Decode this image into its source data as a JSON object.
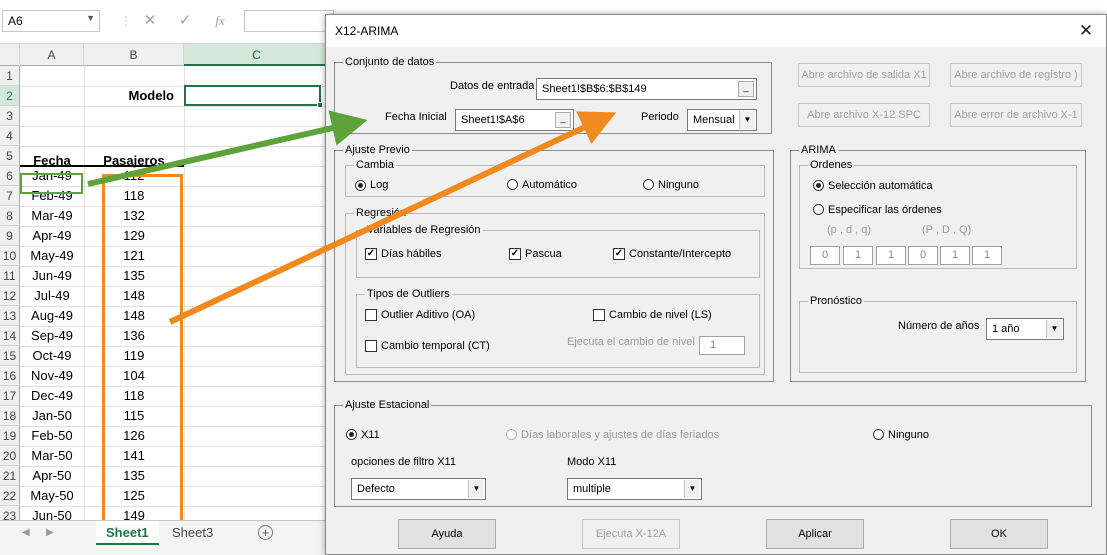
{
  "excel": {
    "namebox": "A6",
    "fx": {
      "cancel": "✕",
      "enter": "✓",
      "function": "fx"
    },
    "columns": [
      "A",
      "B",
      "C"
    ],
    "rows": [
      "1",
      "2",
      "3",
      "4",
      "5",
      "6",
      "7",
      "8",
      "9",
      "10",
      "11",
      "12",
      "13",
      "14",
      "15",
      "16",
      "17",
      "18",
      "19",
      "20",
      "21",
      "22",
      "23"
    ],
    "modelo_label": "Modelo",
    "headers": {
      "fecha": "Fecha",
      "pasajeros": "Pasajeros"
    },
    "data": [
      {
        "fecha": "Jan-49",
        "pasajeros": "112"
      },
      {
        "fecha": "Feb-49",
        "pasajeros": "118"
      },
      {
        "fecha": "Mar-49",
        "pasajeros": "132"
      },
      {
        "fecha": "Apr-49",
        "pasajeros": "129"
      },
      {
        "fecha": "May-49",
        "pasajeros": "121"
      },
      {
        "fecha": "Jun-49",
        "pasajeros": "135"
      },
      {
        "fecha": "Jul-49",
        "pasajeros": "148"
      },
      {
        "fecha": "Aug-49",
        "pasajeros": "148"
      },
      {
        "fecha": "Sep-49",
        "pasajeros": "136"
      },
      {
        "fecha": "Oct-49",
        "pasajeros": "119"
      },
      {
        "fecha": "Nov-49",
        "pasajeros": "104"
      },
      {
        "fecha": "Dec-49",
        "pasajeros": "118"
      },
      {
        "fecha": "Jan-50",
        "pasajeros": "115"
      },
      {
        "fecha": "Feb-50",
        "pasajeros": "126"
      },
      {
        "fecha": "Mar-50",
        "pasajeros": "141"
      },
      {
        "fecha": "Apr-50",
        "pasajeros": "135"
      },
      {
        "fecha": "May-50",
        "pasajeros": "125"
      },
      {
        "fecha": "Jun-50",
        "pasajeros": "149"
      }
    ],
    "sheet_tabs": [
      "Sheet1",
      "Sheet3"
    ],
    "active_sheet": "Sheet1"
  },
  "dialog": {
    "title": "X12-ARIMA",
    "conjunto": {
      "legend": "Conjunto de datos",
      "datos_label": "Datos de entrada",
      "datos_value": "Sheet1!$B$6:$B$149",
      "fecha_label": "Fecha Inicial",
      "fecha_value": "Sheet1!$A$6",
      "periodo_label": "Periodo",
      "periodo_value": "Mensual"
    },
    "file_buttons": [
      "Abre archivo de salida X1",
      "Abre archivo de registro )",
      "Abre archivo X-12 SPC",
      "Abre error de archivo X-1"
    ],
    "ajuste_previo": {
      "legend": "Ajuste Previo",
      "cambia": {
        "legend": "Cambia",
        "options": [
          "Log",
          "Automático",
          "Ninguno"
        ],
        "selected": "Log"
      },
      "regresion": {
        "legend": "Regresión",
        "variables_legend": "Variables de Regresión",
        "checks": [
          {
            "label": "Días hábiles",
            "checked": true
          },
          {
            "label": "Pascua",
            "checked": true
          },
          {
            "label": "Constante/Intercepto",
            "checked": true
          }
        ]
      },
      "outliers": {
        "legend": "Tipos de Outliers",
        "checks": [
          {
            "label": "Outlier Aditivo (OA)",
            "checked": false
          },
          {
            "label": "Cambio de nivel (LS)",
            "checked": false
          },
          {
            "label": "Cambio temporal (CT)",
            "checked": false
          }
        ],
        "ejecuta_label": "Ejecuta el cambio de nivel",
        "ejecuta_value": "1"
      }
    },
    "arima": {
      "legend": "ARIMA",
      "ordenes_legend": "Ordenes",
      "auto_label": "Selección automática",
      "manual_label": "Especificar las órdenes",
      "pdq_label": "(p  , d ,  q)",
      "PDQ_label": "(P  , D ,  Q)",
      "orders": [
        "0",
        "1",
        "1",
        "0",
        "1",
        "1"
      ],
      "selected": "Selección automática"
    },
    "pronostico": {
      "legend": "Pronóstico",
      "label": "Número de años",
      "value": "1 año"
    },
    "estacional": {
      "legend": "Ajuste Estacional",
      "options": [
        "X11",
        "Días laborales y ajustes de días feriados",
        "Ninguno"
      ],
      "selected": "X11",
      "filtro_label": "opciones de filtro X11",
      "filtro_value": "Defecto",
      "modo_label": "Modo X11",
      "modo_value": "multiple"
    },
    "buttons": {
      "ayuda": "Ayuda",
      "ejecuta": "Ejecuta X-12A",
      "aplicar": "Aplicar",
      "ok": "OK"
    }
  },
  "colors": {
    "excel_green": "#217346",
    "arrow_green": "#5ea23a",
    "arrow_orange": "#f08a1f"
  }
}
